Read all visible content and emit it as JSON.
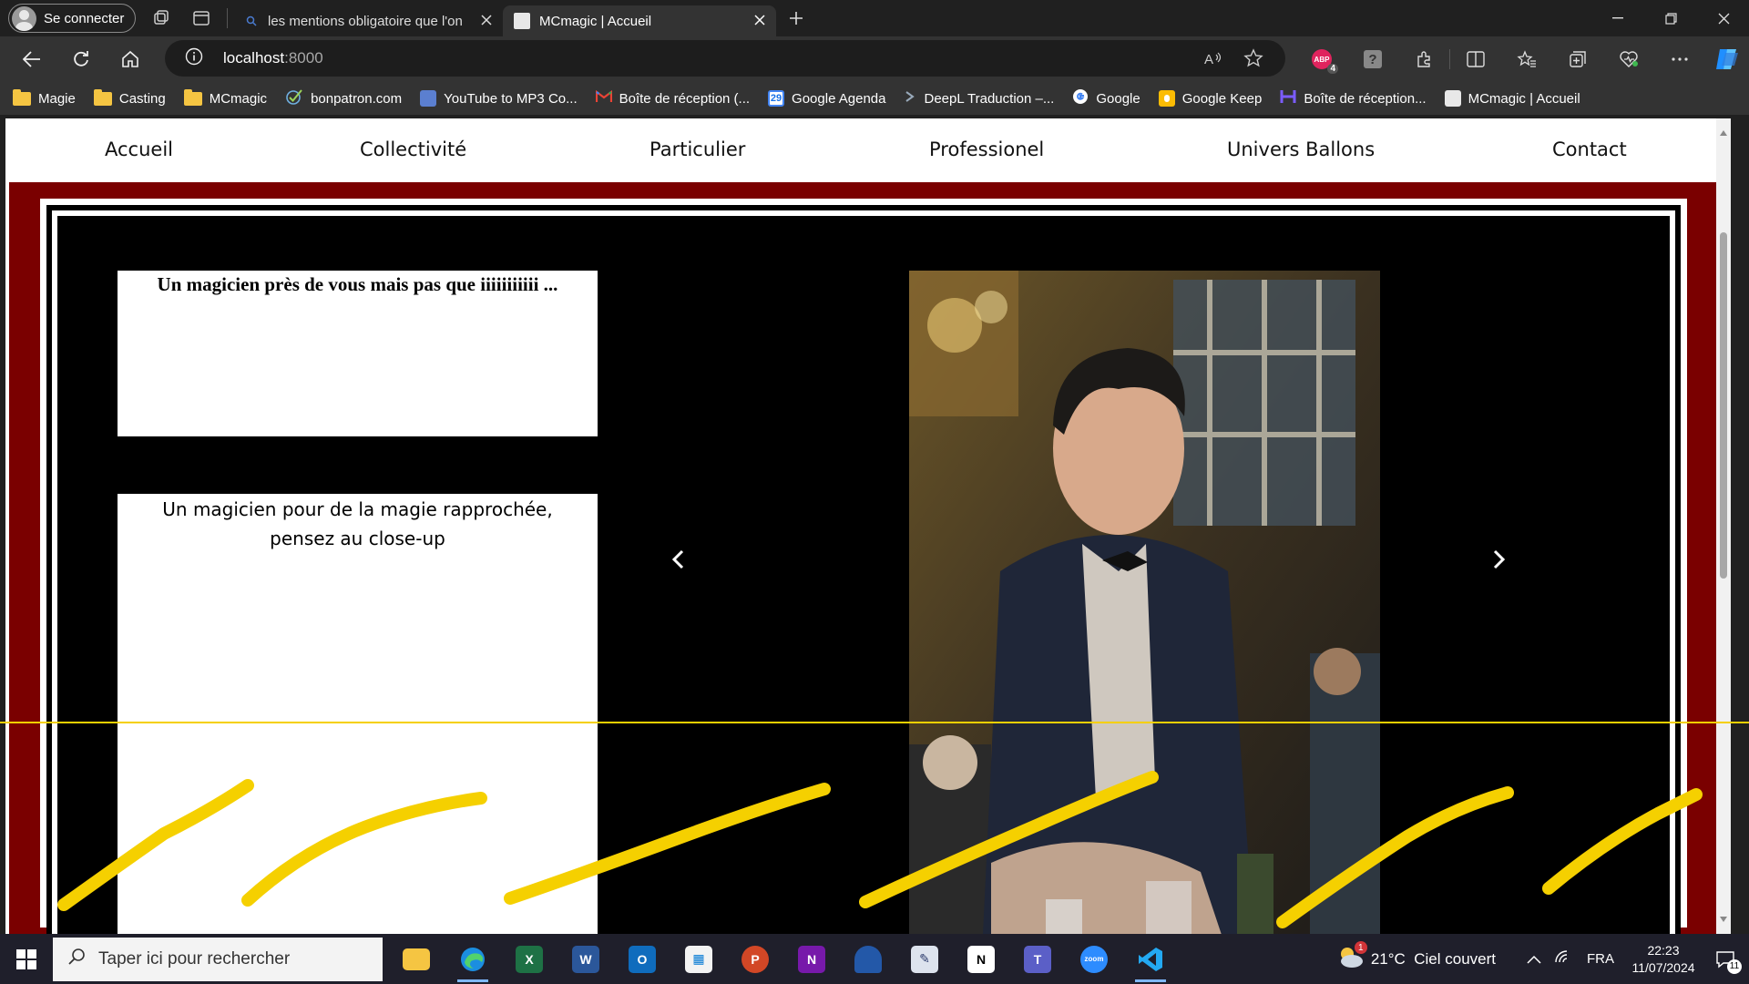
{
  "browser": {
    "profile_label": "Se connecter",
    "tabs": [
      {
        "title": "les mentions obligatoire que l'on",
        "active": false
      },
      {
        "title": "MCmagic | Accueil",
        "active": true
      }
    ],
    "url_host": "localhost",
    "url_port": ":8000",
    "extension_badge": "4"
  },
  "bookmarks": [
    {
      "label": "Magie",
      "icon": "folder-icon"
    },
    {
      "label": "Casting",
      "icon": "folder-icon"
    },
    {
      "label": "MCmagic",
      "icon": "folder-icon"
    },
    {
      "label": "bonpatron.com",
      "icon": "check-icon"
    },
    {
      "label": "YouTube to MP3 Co...",
      "icon": "converter-icon"
    },
    {
      "label": "Boîte de réception (...",
      "icon": "gmail-icon"
    },
    {
      "label": "Google Agenda",
      "icon": "calendar-icon",
      "badge": "29"
    },
    {
      "label": "DeepL Traduction –...",
      "icon": "deepl-icon"
    },
    {
      "label": "Google",
      "icon": "google-icon"
    },
    {
      "label": "Google Keep",
      "icon": "keep-icon"
    },
    {
      "label": "Boîte de réception...",
      "icon": "mail-icon"
    },
    {
      "label": "MCmagic | Accueil",
      "icon": "page-icon"
    }
  ],
  "site": {
    "nav": [
      "Accueil",
      "Collectivité",
      "Particulier",
      "Professionel",
      "Univers Ballons",
      "Contact"
    ],
    "card1_title": "Un magicien près de vous mais pas que iiiiiiiiiii ...",
    "card2_text_line1": "Un magicien pour de la magie rapprochée,",
    "card2_text_line2": "pensez au close-up"
  },
  "taskbar": {
    "search_placeholder": "Taper ici pour rechercher",
    "weather": "21°C  Ciel couvert",
    "weather_badge": "1",
    "language": "FRA",
    "time": "22:23",
    "date": "11/07/2024",
    "notification_count": "11",
    "apps": [
      "file-explorer-icon",
      "edge-icon",
      "excel-icon",
      "word-icon",
      "outlook-icon",
      "store-icon",
      "powerpoint-icon",
      "onenote-icon",
      "app-icon",
      "app-icon",
      "notion-icon",
      "teams-icon",
      "zoom-icon",
      "vscode-icon"
    ]
  },
  "colors": {
    "frame_red": "#7a0000",
    "highlight_yellow": "#f5d000"
  }
}
